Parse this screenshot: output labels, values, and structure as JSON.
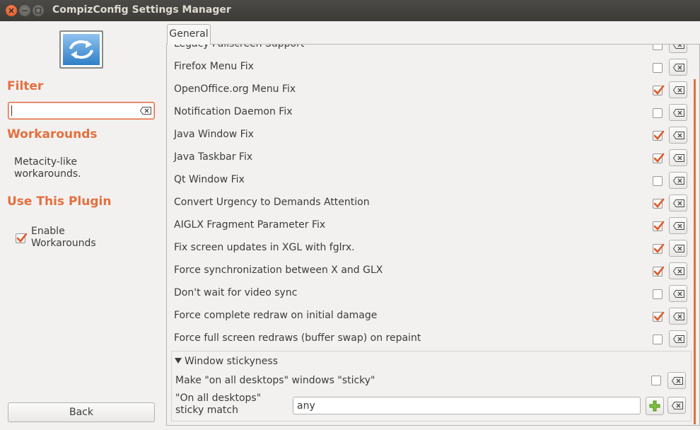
{
  "window": {
    "title": "CompizConfig Settings Manager"
  },
  "sidebar": {
    "filter_heading": "Filter",
    "filter_value": "",
    "plugin_name": "Workarounds",
    "plugin_description": "Metacity-like workarounds.",
    "use_heading": "Use This Plugin",
    "enable_label": "Enable Workarounds",
    "enable_checked": true,
    "back_label": "Back"
  },
  "tabs": [
    {
      "label": "General",
      "active": true
    }
  ],
  "options": [
    {
      "label": "Legacy Fullscreen Support",
      "checked": false
    },
    {
      "label": "Firefox Menu Fix",
      "checked": false
    },
    {
      "label": "OpenOffice.org Menu Fix",
      "checked": true
    },
    {
      "label": "Notification Daemon Fix",
      "checked": false
    },
    {
      "label": "Java Window Fix",
      "checked": true
    },
    {
      "label": "Java Taskbar Fix",
      "checked": true
    },
    {
      "label": "Qt Window Fix",
      "checked": false
    },
    {
      "label": "Convert Urgency to Demands Attention",
      "checked": true
    },
    {
      "label": "AIGLX Fragment Parameter Fix",
      "checked": true
    },
    {
      "label": "Fix screen updates in XGL with fglrx.",
      "checked": true
    },
    {
      "label": "Force synchronization between X and GLX",
      "checked": true
    },
    {
      "label": "Don't wait for video sync",
      "checked": false
    },
    {
      "label": "Force complete redraw on initial damage",
      "checked": true
    },
    {
      "label": "Force full screen redraws (buffer swap) on repaint",
      "checked": false
    }
  ],
  "group": {
    "title": "Window stickyness",
    "sticky_label": "Make \"on all desktops\" windows \"sticky\"",
    "sticky_checked": false,
    "match_label": "\"On all desktops\" sticky match",
    "match_value": "any"
  },
  "colors": {
    "accent": "#e46f3e",
    "check": "#e05a2b"
  }
}
